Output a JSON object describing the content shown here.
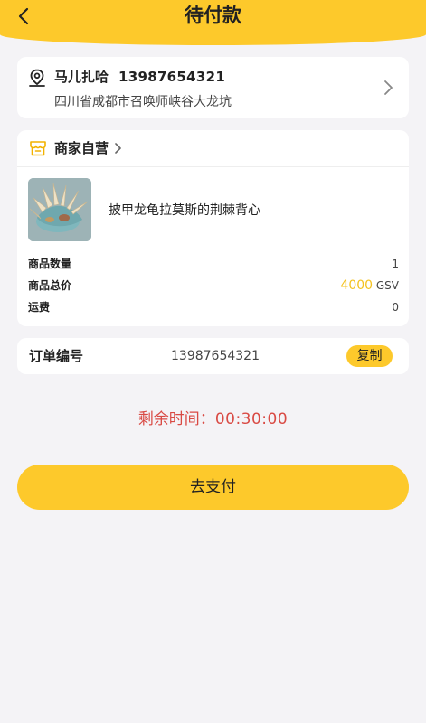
{
  "header": {
    "title": "待付款",
    "back_icon": "chevron-left-icon",
    "bg_color": "#fdc92b"
  },
  "address": {
    "icon": "location-pin-icon",
    "name": "马儿扎哈",
    "phone": "13987654321",
    "detail": "四川省成都市召唤师峡谷大龙坑"
  },
  "shop": {
    "icon": "store-icon",
    "name": "商家自营"
  },
  "product": {
    "name": "披甲龙龟拉莫斯的荆棘背心",
    "rows": [
      {
        "label": "商品数量",
        "value": "1"
      },
      {
        "label": "商品总价",
        "price": "4000",
        "unit": "GSV"
      },
      {
        "label": "运费",
        "value": "0"
      }
    ]
  },
  "order": {
    "label": "订单编号",
    "number": "13987654321",
    "copy_label": "复制"
  },
  "countdown": {
    "label": "剩余时间：",
    "time": "00:30:00",
    "color": "#d94a44"
  },
  "pay_button": {
    "label": "去支付"
  }
}
